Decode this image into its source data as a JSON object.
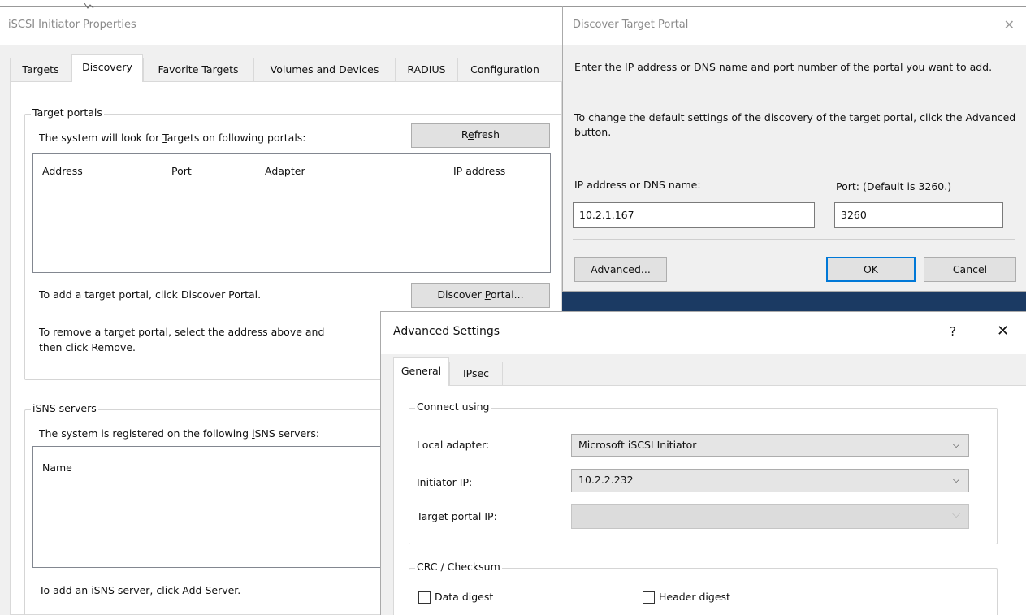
{
  "main_dialog": {
    "title": "iSCSI Initiator Properties",
    "tabs": [
      "Targets",
      "Discovery",
      "Favorite Targets",
      "Volumes and Devices",
      "RADIUS",
      "Configuration"
    ],
    "active_tab": "Discovery",
    "target_portals": {
      "group_label": "Target portals",
      "description_pre": "The system will look for ",
      "description_ul": "T",
      "description_post": "argets on following portals:",
      "refresh_pre": "R",
      "refresh_ul": "e",
      "refresh_post": "fresh",
      "columns": [
        "Address",
        "Port",
        "Adapter",
        "IP address"
      ],
      "rows": [],
      "add_hint": "To add a target portal, click Discover Portal.",
      "discover_pre": "Discover ",
      "discover_ul": "P",
      "discover_post": "ortal...",
      "remove_hint_line1": "To remove a target portal, select the address above and",
      "remove_hint_line2": "then click Remove."
    },
    "isns": {
      "group_label": "iSNS servers",
      "description_pre": "The system is registered on the following ",
      "description_ul": "i",
      "description_post": "SNS servers:",
      "columns": [
        "Name"
      ],
      "add_hint": "To add an iSNS server, click Add Server."
    }
  },
  "discover_dialog": {
    "title": "Discover Target Portal",
    "close_glyph": "✕",
    "intro": "Enter the IP address or DNS name and port number of the portal you want to add.",
    "intro2": "To change the default settings of the discovery of the target portal, click the Advanced button.",
    "ip_label": "IP address or DNS name:",
    "ip_value": "10.2.1.167",
    "port_label": "Port: (Default is 3260.)",
    "port_value": "3260",
    "advanced_label": "Advanced...",
    "ok_label": "OK",
    "cancel_label": "Cancel"
  },
  "advanced_dialog": {
    "title": "Advanced Settings",
    "help_glyph": "?",
    "close_glyph": "✕",
    "tabs": [
      "General",
      "IPsec"
    ],
    "active_tab": "General",
    "connect_group": "Connect using",
    "local_adapter_label": "Local adapter:",
    "local_adapter_value": "Microsoft iSCSI Initiator",
    "initiator_ip_label": "Initiator IP:",
    "initiator_ip_value": "10.2.2.232",
    "target_portal_ip_label": "Target portal IP:",
    "target_portal_ip_value": "",
    "crc_group": "CRC / Checksum",
    "data_digest_label": "Data digest",
    "header_digest_label": "Header digest",
    "data_digest_checked": false,
    "header_digest_checked": false
  },
  "colors": {
    "window_bg": "#f0f0f0",
    "titlebar_bg": "#ffffff",
    "accent": "#0078d7",
    "desktop_blue": "#1b3a63"
  },
  "icons": {
    "dropdown": "chevron-down-icon",
    "close": "close-icon",
    "help": "help-icon"
  }
}
